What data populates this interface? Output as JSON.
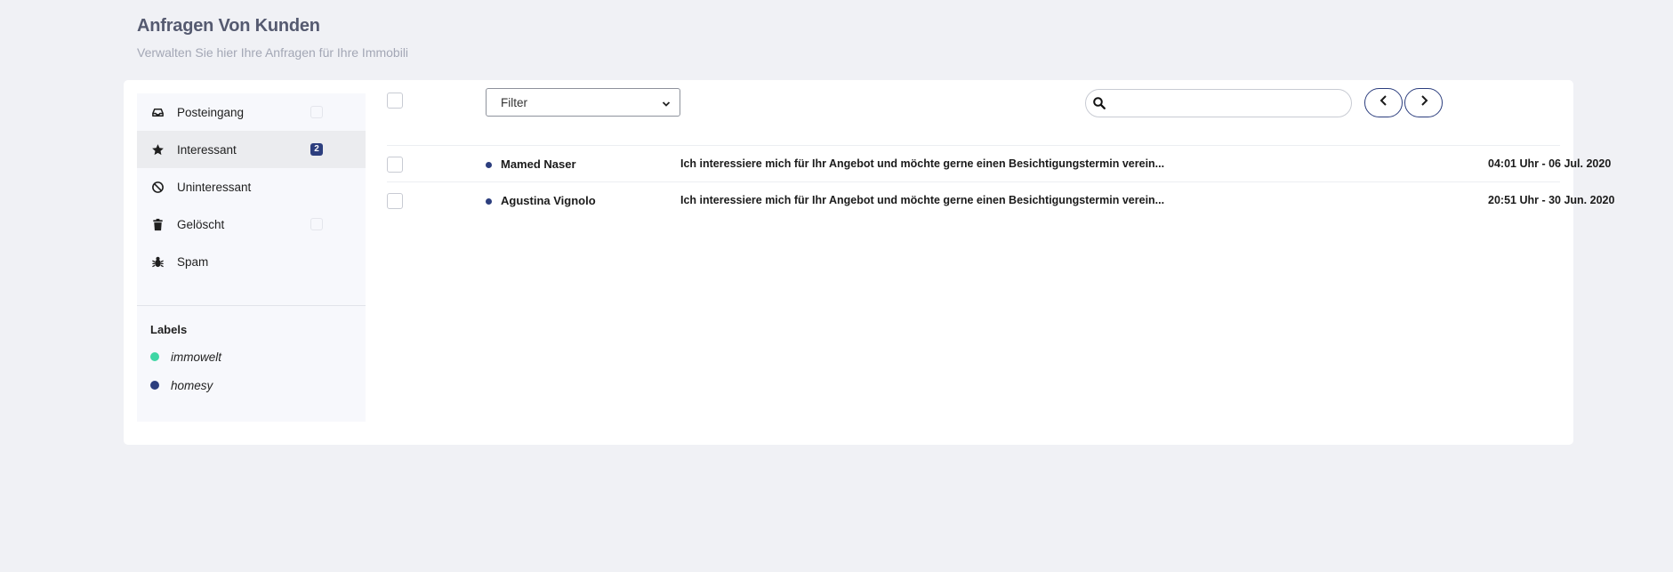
{
  "header": {
    "title": "Anfragen Von Kunden",
    "subtitle": "Verwalten Sie hier Ihre Anfragen für Ihre Immobili"
  },
  "sidebar": {
    "folders": [
      {
        "label": "Posteingang",
        "icon": "inbox-icon",
        "badge": ""
      },
      {
        "label": "Interessant",
        "icon": "star-icon",
        "badge": "2",
        "active": true
      },
      {
        "label": "Uninteressant",
        "icon": "ban-icon"
      },
      {
        "label": "Gelöscht",
        "icon": "trash-icon",
        "badge": ""
      },
      {
        "label": "Spam",
        "icon": "bug-icon"
      }
    ],
    "labels_title": "Labels",
    "labels": [
      {
        "name": "immowelt",
        "color": "#3ed6a4"
      },
      {
        "name": "homesy",
        "color": "#2c3e7e"
      }
    ]
  },
  "toolbar": {
    "filter_selected": "Filter",
    "search_placeholder": "",
    "search_value": ""
  },
  "messages": [
    {
      "sender": "Mamed Naser",
      "subject": "Ich interessiere mich für Ihr Angebot und möchte gerne einen Besichtigungstermin verein...",
      "time": "04:01 Uhr - 06 Jul. 2020"
    },
    {
      "sender": "Agustina Vignolo",
      "subject": "Ich interessiere mich für Ihr Angebot und möchte gerne einen Besichtigungstermin verein...",
      "time": "20:51 Uhr - 30 Jun. 2020"
    }
  ],
  "colors": {
    "accent": "#2c3e7e",
    "background": "#f0f1f5"
  }
}
